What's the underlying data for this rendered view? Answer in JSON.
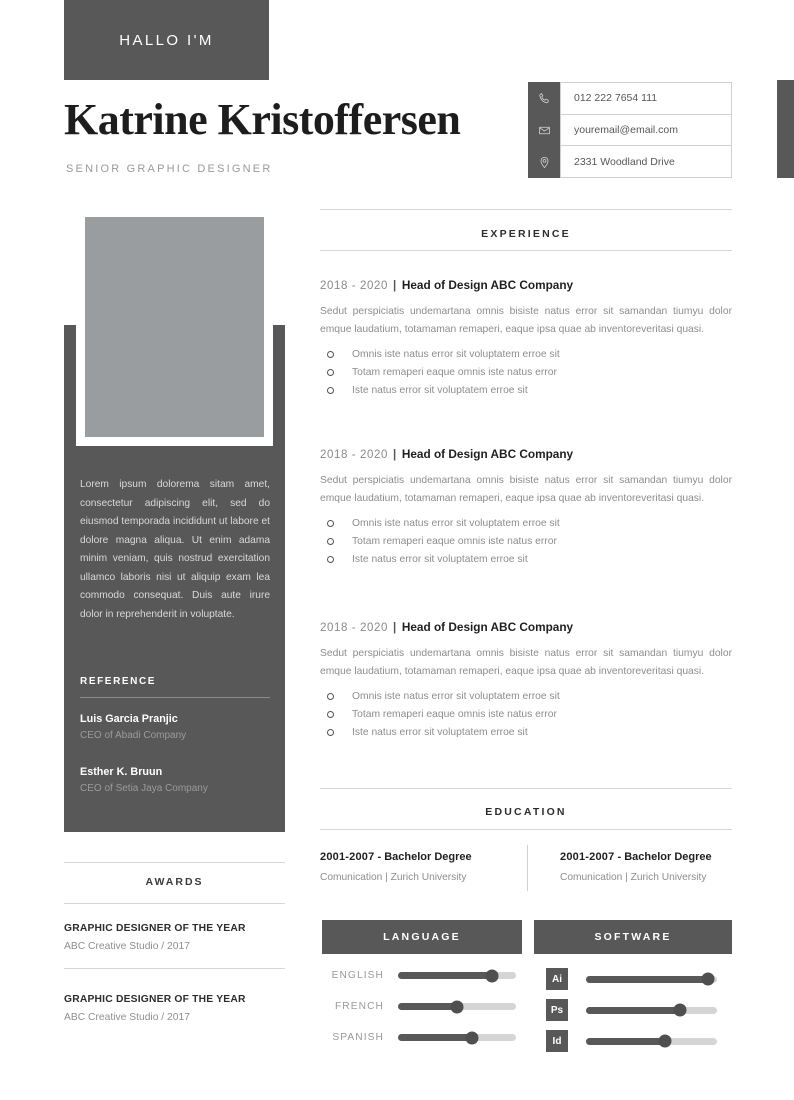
{
  "header": {
    "greeting": "HALLO I'M",
    "name": "Katrine Kristoffersen",
    "role": "SENIOR GRAPHIC DESIGNER"
  },
  "contact": [
    {
      "icon": "phone-icon",
      "value": "012 222 7654 111"
    },
    {
      "icon": "envelope-icon",
      "value": "youremail@email.com"
    },
    {
      "icon": "location-pin-icon",
      "value": "2331 Woodland Drive"
    }
  ],
  "sidebar": {
    "bio": "Lorem ipsum dolorema sitam amet, consectetur adipiscing elit, sed do eiusmod temporada incididunt ut labore et dolore magna aliqua. Ut enim adama minim veniam, quis nostrud exercitation ullamco laboris nisi ut aliquip exam lea commodo consequat. Duis aute irure dolor in reprehenderit in voluptate.",
    "reference_title": "REFERENCE",
    "references": [
      {
        "name": "Luis Garcia Pranjic",
        "role": "CEO of Abadi Company"
      },
      {
        "name": "Esther K. Bruun",
        "role": "CEO of Setia Jaya Company"
      }
    ]
  },
  "awards": {
    "title": "AWARDS",
    "items": [
      {
        "name": "GRAPHIC DESIGNER OF THE YEAR",
        "sub": "ABC Creative Studio / 2017"
      },
      {
        "name": "GRAPHIC DESIGNER OF THE YEAR",
        "sub": "ABC Creative Studio / 2017"
      }
    ]
  },
  "experience": {
    "title": "EXPERIENCE",
    "items": [
      {
        "years": "2018 - 2020",
        "separator": "|",
        "position": "Head of Design ABC Company",
        "description": "Sedut perspiciatis undemartana omnis bisiste natus error sit samandan tiumyu dolor emque laudatium, totamaman remaperi, eaque ipsa quae ab inventoreveritasi quasi.",
        "bullets": [
          "Omnis iste natus error sit voluptatem erroe sit",
          "Totam remaperi eaque omnis iste natus error",
          "Iste natus error sit voluptatem erroe sit"
        ]
      },
      {
        "years": "2018 - 2020",
        "separator": "|",
        "position": "Head of Design ABC Company",
        "description": "Sedut perspiciatis undemartana omnis bisiste natus error sit samandan tiumyu dolor emque laudatium, totamaman remaperi, eaque ipsa quae ab inventoreveritasi quasi.",
        "bullets": [
          "Omnis iste natus error sit voluptatem erroe sit",
          "Totam remaperi eaque omnis iste natus error",
          "Iste natus error sit voluptatem erroe sit"
        ]
      },
      {
        "years": "2018 - 2020",
        "separator": "|",
        "position": "Head of Design ABC Company",
        "description": "Sedut perspiciatis undemartana omnis bisiste natus error sit samandan tiumyu dolor emque laudatium, totamaman remaperi, eaque ipsa quae ab inventoreveritasi quasi.",
        "bullets": [
          "Omnis iste natus error sit voluptatem erroe sit",
          "Totam remaperi eaque omnis iste natus error",
          "Iste natus error sit voluptatem erroe sit"
        ]
      }
    ]
  },
  "education": {
    "title": "EDUCATION",
    "items": [
      {
        "years": "2001-2007",
        "dot": "-",
        "degree": "Bachelor Degree",
        "detail": "Comunication  |  Zurich University"
      },
      {
        "years": "2001-2007",
        "dot": "-",
        "degree": "Bachelor Degree",
        "detail": "Comunication  |  Zurich University"
      }
    ]
  },
  "language": {
    "title": "LANGUAGE",
    "items": [
      {
        "label": "ENGLISH",
        "level": 80
      },
      {
        "label": "FRENCH",
        "level": 50
      },
      {
        "label": "SPANISH",
        "level": 63
      }
    ]
  },
  "software": {
    "title": "SOFTWARE",
    "items": [
      {
        "label": "Ai",
        "level": 93
      },
      {
        "label": "Ps",
        "level": 72
      },
      {
        "label": "Id",
        "level": 60
      }
    ]
  },
  "colors": {
    "dark": "#585858",
    "photo": "#9a9da0",
    "muted": "#8d8d8d",
    "rule": "#d7d7d7"
  }
}
